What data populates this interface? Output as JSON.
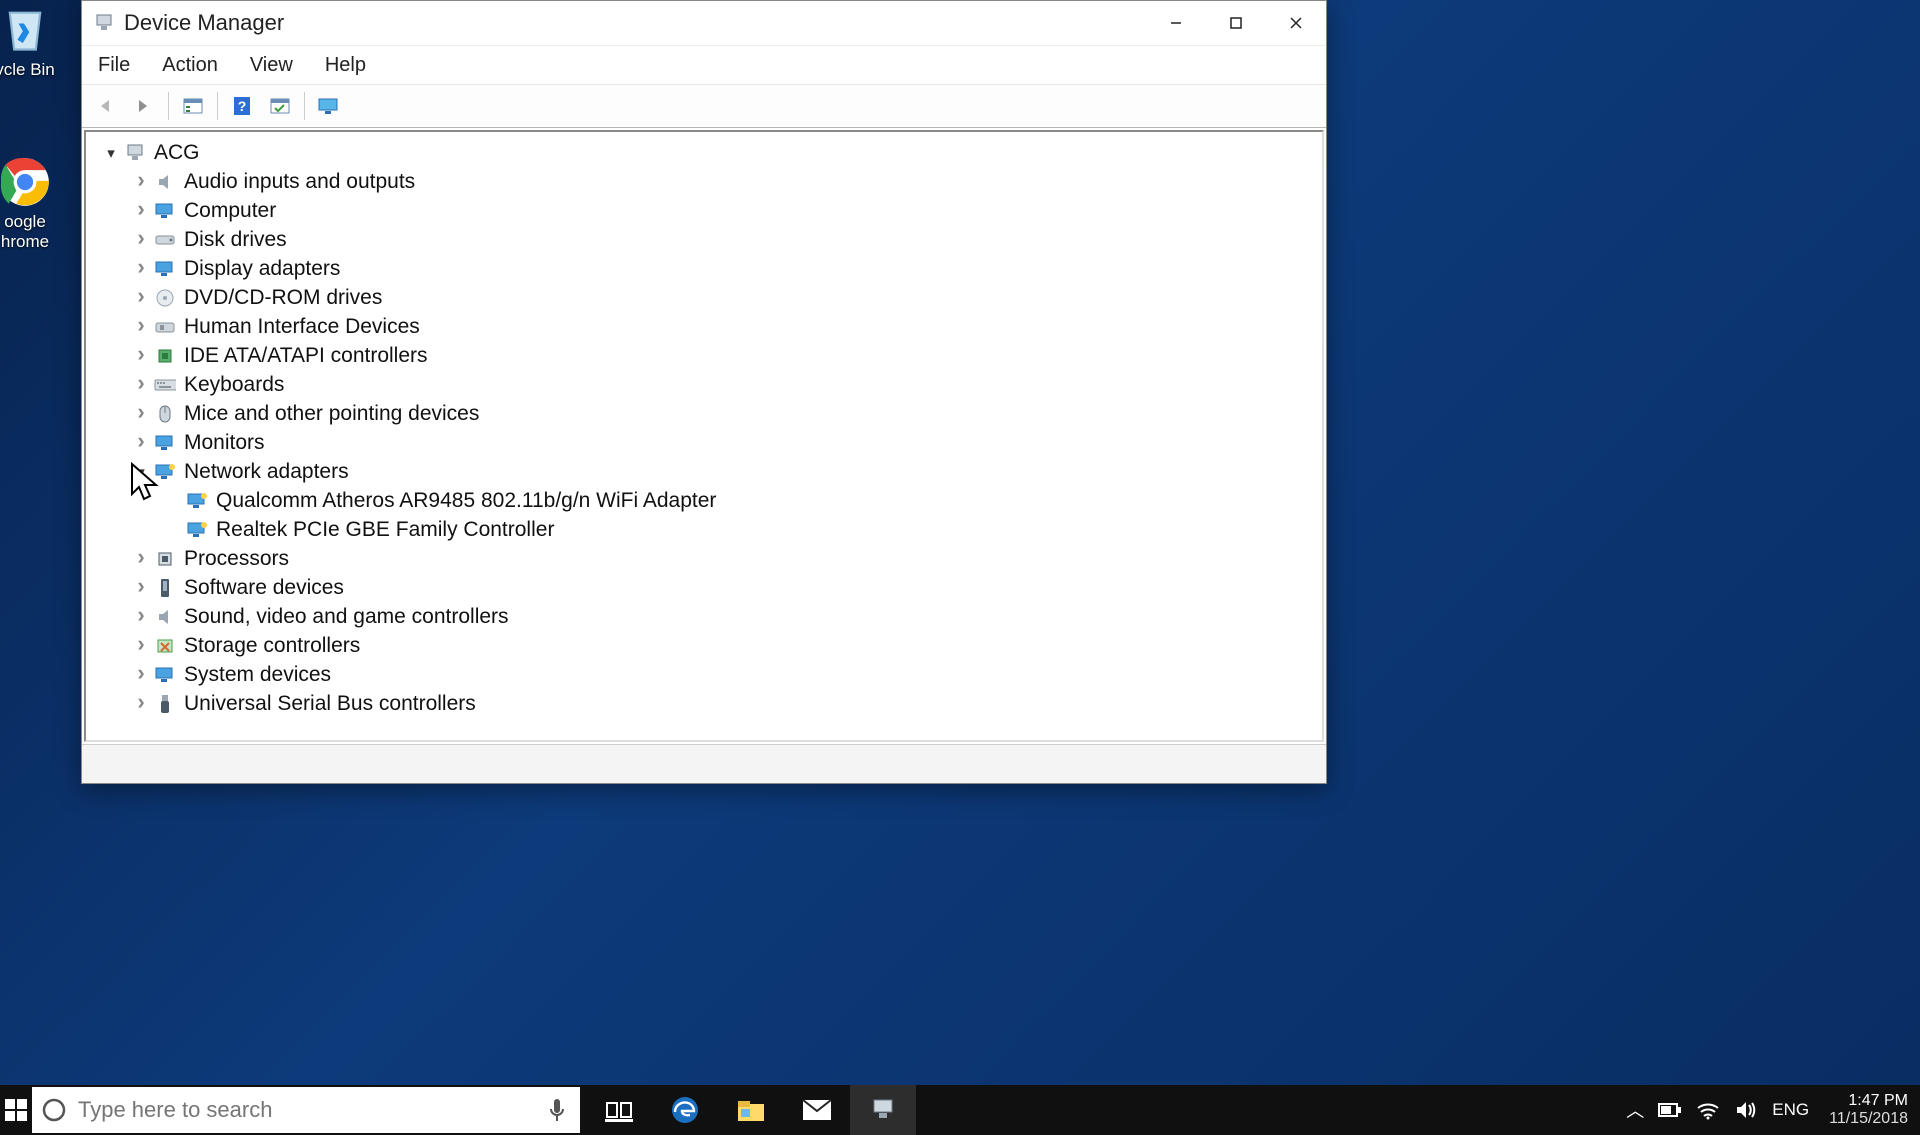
{
  "desktop": {
    "recycle_bin": "ycle Bin",
    "chrome_line1": "oogle",
    "chrome_line2": "hrome"
  },
  "window": {
    "title": "Device Manager",
    "menu": {
      "file": "File",
      "action": "Action",
      "view": "View",
      "help": "Help"
    }
  },
  "tree": {
    "root": "ACG",
    "categories": [
      {
        "label": "Audio inputs and outputs",
        "icon": "speaker"
      },
      {
        "label": "Computer",
        "icon": "monitor"
      },
      {
        "label": "Disk drives",
        "icon": "hdd"
      },
      {
        "label": "Display adapters",
        "icon": "monitor"
      },
      {
        "label": "DVD/CD-ROM drives",
        "icon": "disc"
      },
      {
        "label": "Human Interface Devices",
        "icon": "hid"
      },
      {
        "label": "IDE ATA/ATAPI controllers",
        "icon": "chip"
      },
      {
        "label": "Keyboards",
        "icon": "keyboard"
      },
      {
        "label": "Mice and other pointing devices",
        "icon": "mouse"
      },
      {
        "label": "Monitors",
        "icon": "monitor"
      },
      {
        "label": "Network adapters",
        "icon": "net",
        "expanded": true,
        "children": [
          {
            "label": "Qualcomm Atheros AR9485 802.11b/g/n WiFi Adapter",
            "icon": "net"
          },
          {
            "label": "Realtek PCIe GBE Family Controller",
            "icon": "net"
          }
        ]
      },
      {
        "label": "Processors",
        "icon": "cpu"
      },
      {
        "label": "Software devices",
        "icon": "soft"
      },
      {
        "label": "Sound, video and game controllers",
        "icon": "speaker"
      },
      {
        "label": "Storage controllers",
        "icon": "storage"
      },
      {
        "label": "System devices",
        "icon": "system"
      },
      {
        "label": "Universal Serial Bus controllers",
        "icon": "usb"
      }
    ]
  },
  "taskbar": {
    "search_placeholder": "Type here to search",
    "lang": "ENG",
    "time": "1:47 PM",
    "date": "11/15/2018"
  }
}
